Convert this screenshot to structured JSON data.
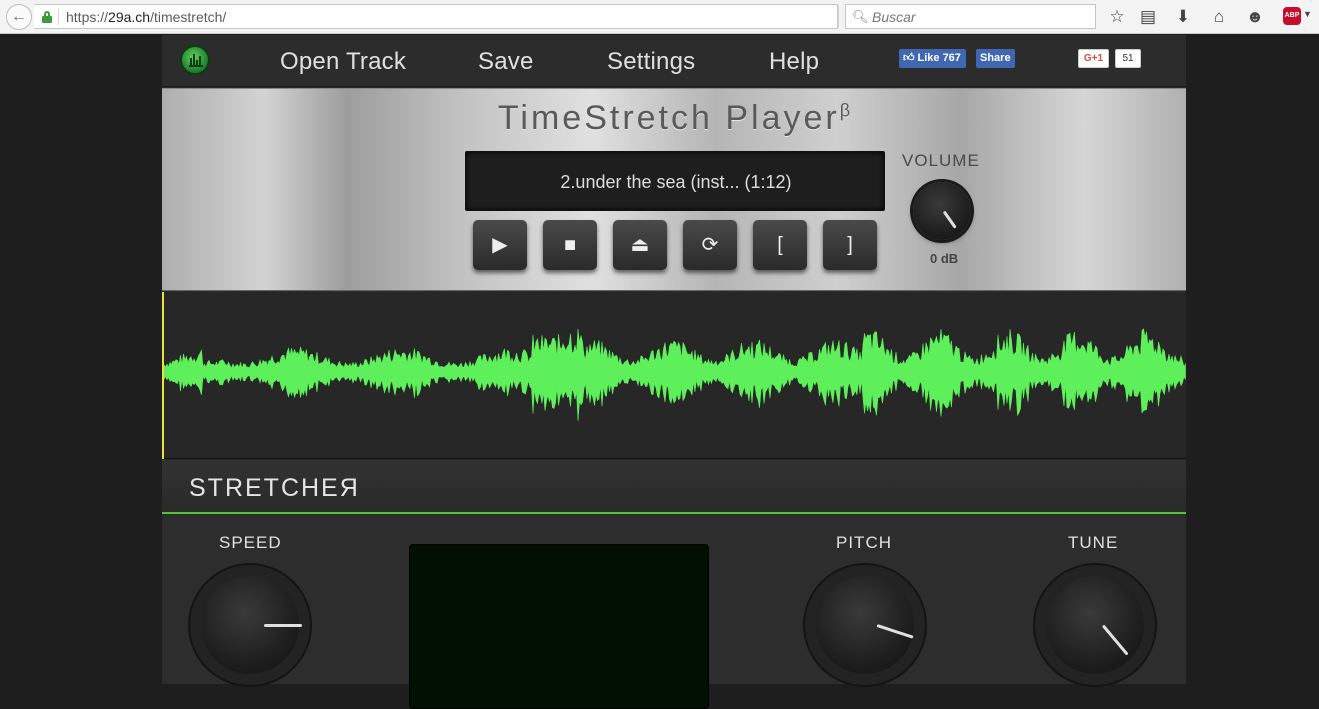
{
  "browser": {
    "url_prefix": "https://",
    "url_domain": "29a.ch",
    "url_path": "/timestretch/",
    "search_placeholder": "Buscar",
    "abp_label": "ABP"
  },
  "nav": {
    "open_track": "Open Track",
    "save": "Save",
    "settings": "Settings",
    "help": "Help",
    "fb_like": "Like 767",
    "fb_share": "Share",
    "gplus": "G+1",
    "gplus_count": "51"
  },
  "player": {
    "title": "TimeStretch Player",
    "title_sup": "β",
    "track": "2.under the sea (inst... (1:12)",
    "volume_label": "VOLUME",
    "volume_value": "0 dB",
    "buttons": {
      "play": "▶",
      "stop": "■",
      "eject": "⏏",
      "loop": "⟳",
      "loop_start": "[",
      "loop_end": "]"
    }
  },
  "stretcher": {
    "title": "STRETCHEЯ",
    "speed_label": "SPEED",
    "pitch_label": "PITCH",
    "tune_label": "TUNE"
  },
  "colors": {
    "waveform": "#5ef05a",
    "accent_green": "#55c13a",
    "playhead": "#e7e33a"
  }
}
